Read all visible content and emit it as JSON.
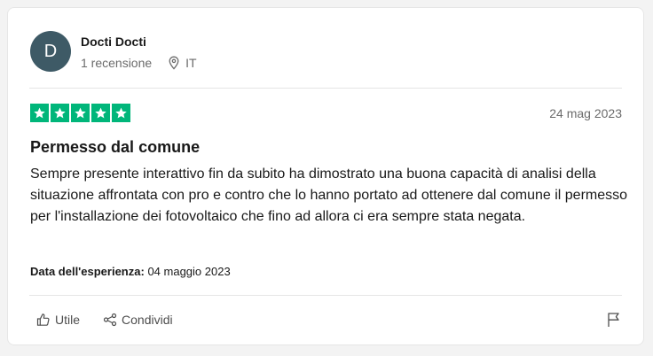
{
  "reviewer": {
    "initial": "D",
    "name": "Docti Docti",
    "review_count": "1 recensione",
    "country": "IT",
    "avatar_color": "#3e5a66"
  },
  "rating": {
    "stars": 5,
    "max": 5,
    "color": "#00b67a"
  },
  "review": {
    "date": "24 mag 2023",
    "title": "Permesso dal comune",
    "body": "Sempre presente interattivo fin da subito ha dimostrato una buona capacità di analisi della situazione affrontata con pro e contro che lo hanno portato ad ottenere dal comune il permesso per l'installazione dei fotovoltaico che fino ad allora ci era sempre stata negata.",
    "experience_label": "Data dell'esperienza:",
    "experience_date": "04 maggio 2023"
  },
  "actions": {
    "useful_label": "Utile",
    "share_label": "Condividi",
    "useful_icon": "thumbs-up-icon",
    "share_icon": "share-icon",
    "report_icon": "flag-icon"
  }
}
